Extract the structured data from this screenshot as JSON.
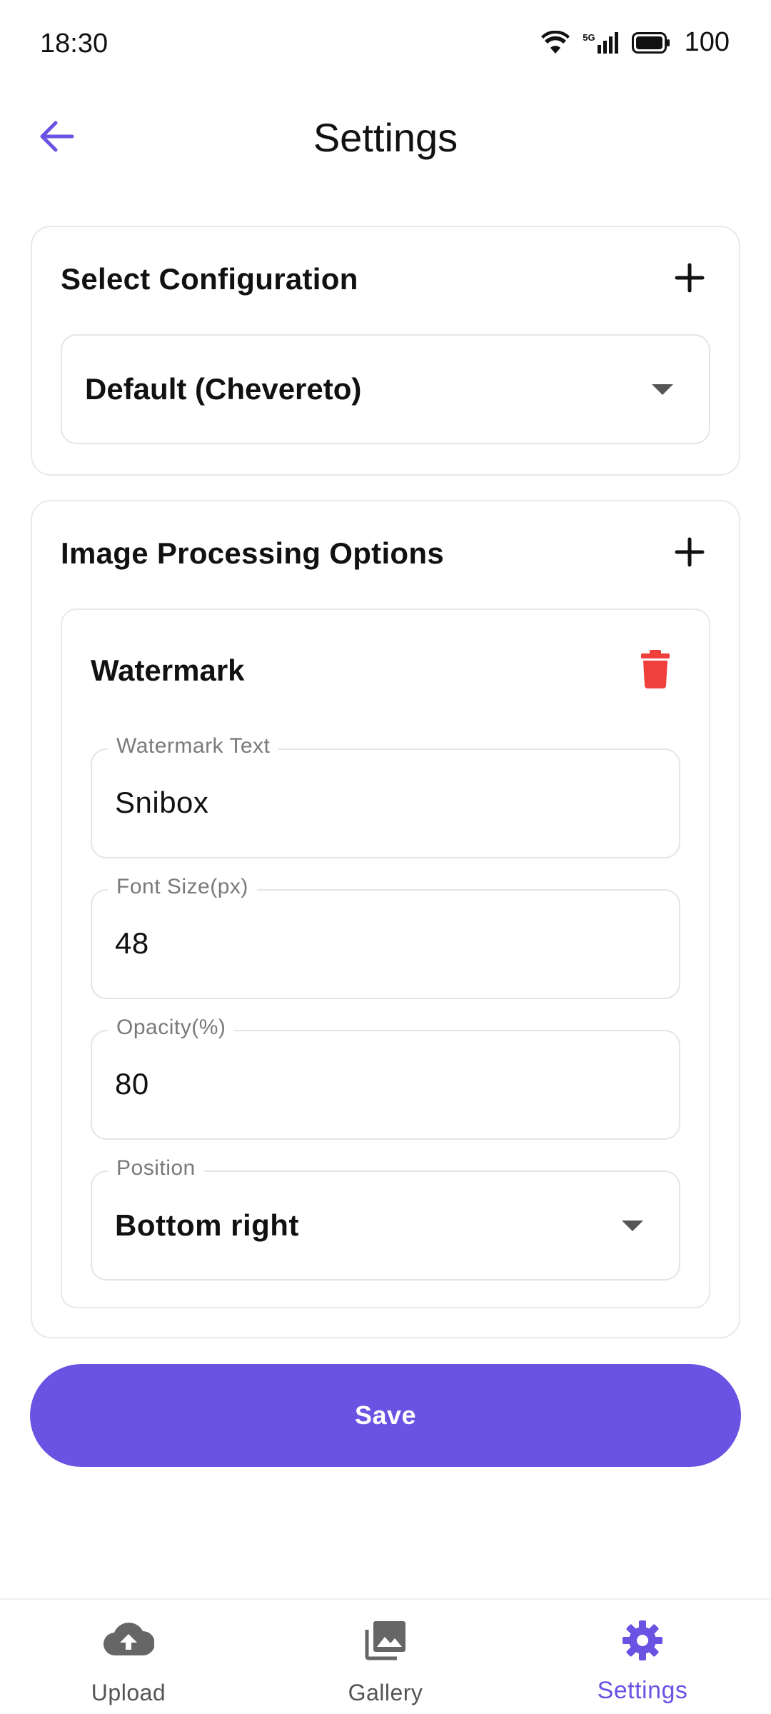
{
  "status_bar": {
    "time": "18:30",
    "network": "5G",
    "battery": "100"
  },
  "app_bar": {
    "title": "Settings"
  },
  "config_card": {
    "title": "Select Configuration",
    "selected": "Default (Chevereto)"
  },
  "processing_card": {
    "title": "Image Processing Options",
    "watermark": {
      "title": "Watermark",
      "text_label": "Watermark Text",
      "text_value": "Snibox",
      "font_size_label": "Font Size(px)",
      "font_size_value": "48",
      "opacity_label": "Opacity(%)",
      "opacity_value": "80",
      "position_label": "Position",
      "position_value": "Bottom right"
    }
  },
  "save_label": "Save",
  "nav": {
    "items": [
      {
        "label": "Upload",
        "icon": "cloud-upload-icon"
      },
      {
        "label": "Gallery",
        "icon": "gallery-icon"
      },
      {
        "label": "Settings",
        "icon": "gear-icon"
      }
    ],
    "active": "Settings"
  },
  "colors": {
    "accent": "#6a52e2",
    "danger": "#f0403c",
    "icon_gray": "#666666"
  }
}
